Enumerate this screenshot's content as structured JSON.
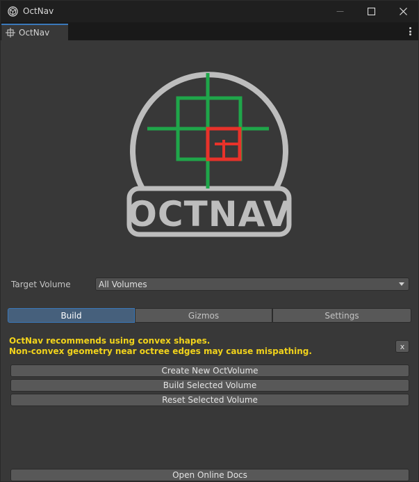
{
  "window": {
    "title": "OctNav"
  },
  "tabstrip": {
    "tab_label": "OctNav"
  },
  "logo": {
    "text": "OCTNAV",
    "colors": {
      "outline": "#bdbdbd",
      "green": "#1fa64a",
      "red": "#e8322a"
    }
  },
  "target_volume": {
    "label": "Target Volume",
    "selected": "All Volumes"
  },
  "tabs": [
    {
      "label": "Build",
      "active": true
    },
    {
      "label": "Gizmos",
      "active": false
    },
    {
      "label": "Settings",
      "active": false
    }
  ],
  "warning": {
    "line1": "OctNav recommends using convex shapes.",
    "line2": "Non-convex geometry near octree edges may cause mispathing.",
    "dismiss_label": "x",
    "color": "#f2d31b"
  },
  "actions": {
    "create": "Create New OctVolume",
    "build": "Build Selected Volume",
    "reset": "Reset Selected Volume"
  },
  "footer": {
    "docs": "Open Online Docs"
  },
  "icons": {
    "app": "unity-cube-icon",
    "tab": "crosshair-grid-icon",
    "menu": "more-vertical-icon",
    "minimize": "minimize-icon",
    "maximize": "maximize-icon",
    "close": "close-icon",
    "dropdown": "chevron-down-icon"
  },
  "accent": "#3a79bb"
}
